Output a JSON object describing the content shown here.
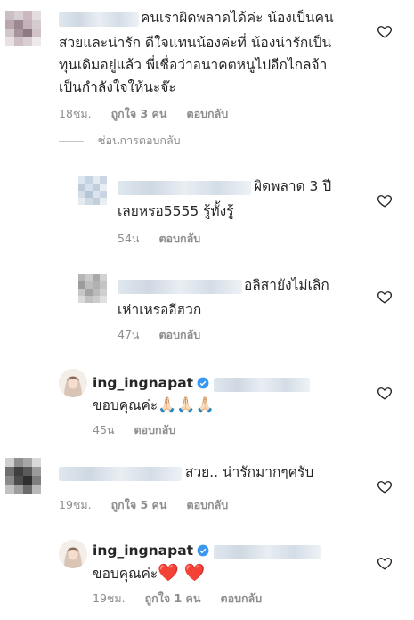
{
  "comments": [
    {
      "text_lines": [
        "คนเราผิดพลาดได้ค่ะ น้องเป็นคน",
        "สวยและน่ารัก ดีใจแทนน้องค่ะที่ น้องน่ารักเป็น",
        "ทุนเดิมอยู่แล้ว พี่เชื่อว่าอนาคตหนูไปอีกไกลจ้า",
        "เป็นกำลังใจให้นะจ๊ะ"
      ],
      "time": "18ชม.",
      "likes": "ถูกใจ 3 คน",
      "reply": "ตอบกลับ"
    },
    {
      "text_lines": [
        "ผิดพลาด 3 ปี",
        "เลยหรอ5555 รู้ทั้งรู้"
      ],
      "time": "54น",
      "reply": "ตอบกลับ"
    },
    {
      "text_lines": [
        "อลิสายังไม่เลิก",
        "เห่าเหรออีฮวก"
      ],
      "time": "47น",
      "reply": "ตอบกลับ"
    },
    {
      "username": "ing_ingnapat",
      "text": "ขอบคุณค่ะ",
      "emoji": "🙏🏻🙏🏻🙏🏻",
      "time": "45น",
      "reply": "ตอบกลับ"
    },
    {
      "text": "สวย.. น่ารักมากๆครับ",
      "time": "19ชม.",
      "likes": "ถูกใจ 5 คน",
      "reply": "ตอบกลับ"
    },
    {
      "username": "ing_ingnapat",
      "text": "ขอบคุณค่ะ",
      "emoji": "❤️ ❤️",
      "time": "19ชม.",
      "likes": "ถูกใจ 1 คน",
      "reply": "ตอบกลับ"
    }
  ],
  "hide_replies": "ซ่อนการตอบกลับ",
  "colors": {
    "text": "#262626",
    "meta": "#8e8e8e",
    "verified": "#3897f0",
    "heart_emoji": "#ed1c24"
  },
  "icons": [
    "heart-outline-icon",
    "verified-badge-icon"
  ]
}
